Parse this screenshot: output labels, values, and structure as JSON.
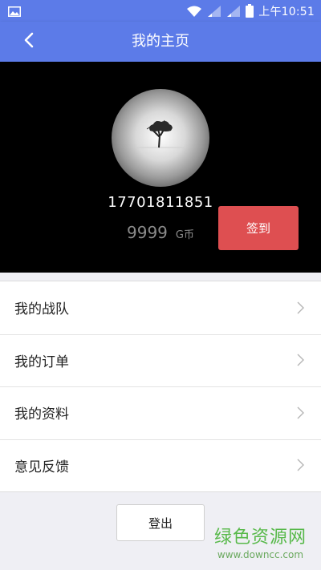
{
  "status_bar": {
    "time": "上午10:51",
    "icons": [
      "image-icon",
      "wifi-icon",
      "signal-icon",
      "signal-icon",
      "battery-icon"
    ]
  },
  "header": {
    "title": "我的主页",
    "back_icon": "chevron-left-icon"
  },
  "profile": {
    "phone": "17701811851",
    "coins": "9999",
    "coin_unit": "G币",
    "checkin_label": "签到"
  },
  "menu": {
    "items": [
      {
        "label": "我的战队"
      },
      {
        "label": "我的订单"
      },
      {
        "label": "我的资料"
      },
      {
        "label": "意见反馈"
      }
    ]
  },
  "logout_label": "登出",
  "watermark": {
    "title": "绿色资源网",
    "url": "www.downcc.com"
  },
  "colors": {
    "nav": "#5c7be8",
    "checkin": "#de4f51",
    "watermark": "#58b94a"
  }
}
